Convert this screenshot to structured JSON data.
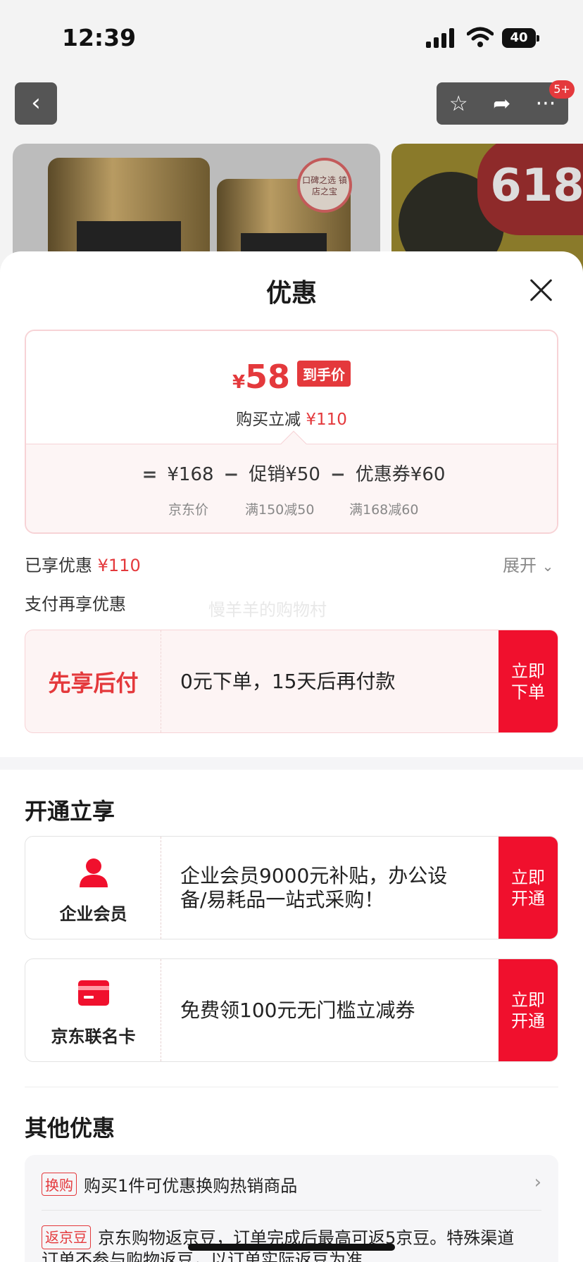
{
  "status_bar": {
    "time": "12:39",
    "battery": "40"
  },
  "header": {
    "notif_badge": "5+"
  },
  "product": {
    "seal_text": "口碑之选 镇店之宝",
    "badge_618": "618"
  },
  "sheet": {
    "title": "优惠",
    "price_card": {
      "yen": "¥",
      "price": "58",
      "price_tag": "到手价",
      "save_prefix": "购买立减",
      "save_amount": "¥110",
      "eq": "=",
      "base_price": "¥168",
      "minus1": "−",
      "promo": "促销¥50",
      "minus2": "−",
      "coupon": "优惠券¥60",
      "base_label": "京东价",
      "promo_label": "满150减50",
      "coupon_label": "满168减60"
    },
    "enjoyed_label": "已享优惠",
    "enjoyed_amount": "¥110",
    "expand_label": "展开",
    "pay_again_label": "支付再享优惠",
    "watermark": "慢羊羊的购物村",
    "pay_later": {
      "name": "先享后付",
      "desc": "0元下单，15天后再付款",
      "button": "立即下单"
    },
    "open_section_title": "开通立享",
    "enterprise": {
      "label": "企业会员",
      "desc": "企业会员9000元补贴，办公设备/易耗品一站式采购！",
      "button": "立即开通"
    },
    "jd_card": {
      "label": "京东联名卡",
      "desc": "免费领100元无门槛立减券",
      "button": "立即开通"
    },
    "other_section_title": "其他优惠",
    "other": [
      {
        "tag": "换购",
        "text": "购买1件可优惠换购热销商品"
      },
      {
        "tag": "返京豆",
        "text": "京东购物返京豆，订单完成后最高可返5京豆。特殊渠道订单不参与购物返豆，以订单实际返豆为准"
      }
    ]
  },
  "colors": {
    "accent": "#e4393c",
    "button_red": "#f0102d"
  }
}
